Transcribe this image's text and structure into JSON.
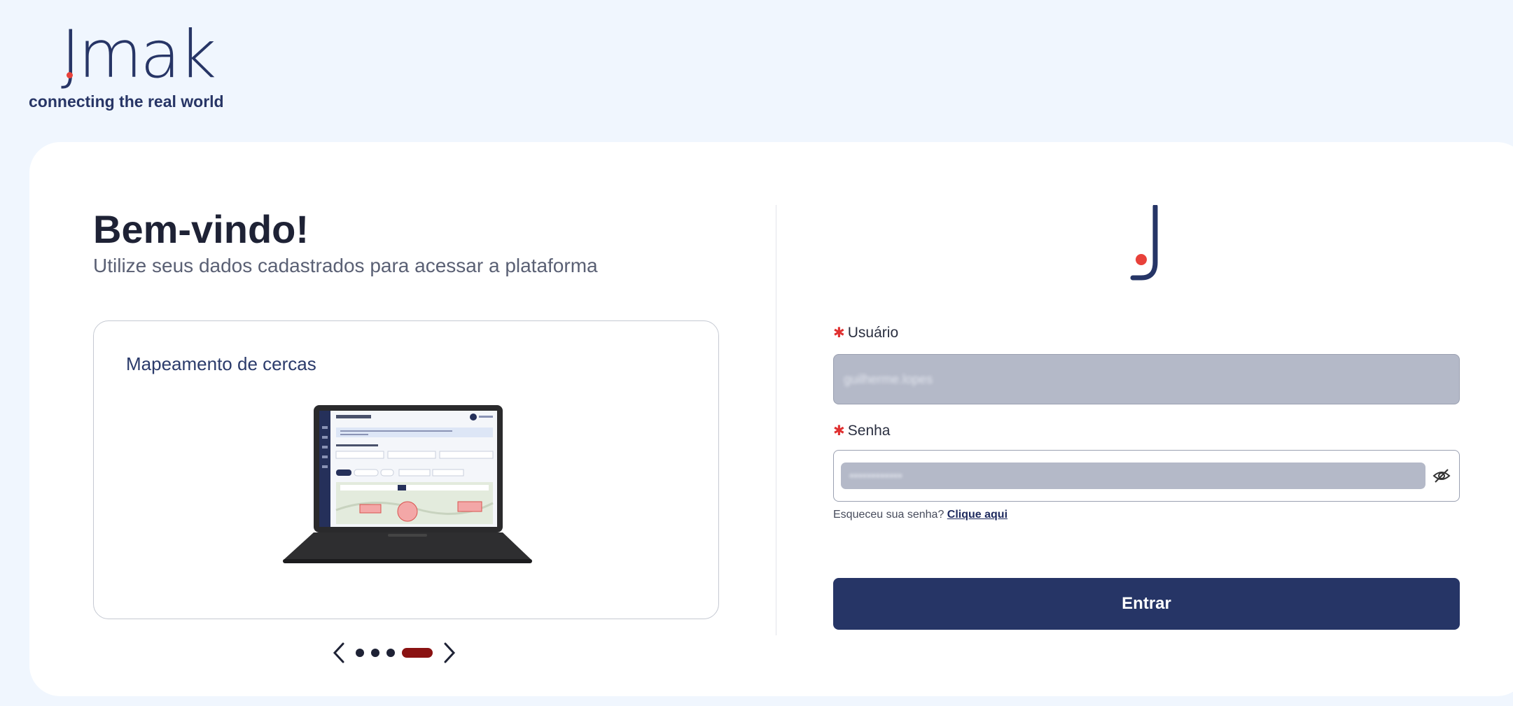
{
  "brand": {
    "logo_text": "Jmak",
    "tagline": "connecting the real world"
  },
  "welcome": {
    "title": "Bem-vindo!",
    "subtitle": "Utilize seus dados cadastrados para acessar a plataforma"
  },
  "carousel": {
    "slide_title": "Mapeamento de cercas",
    "total_slides": 4,
    "active_slide": 4
  },
  "form": {
    "username_label": "Usuário",
    "username_value": "guilherme.lopes",
    "password_label": "Senha",
    "password_value": "••••••••••••",
    "forgot_text": "Esqueceu sua senha?",
    "forgot_link": "Clique aqui",
    "submit_label": "Entrar"
  },
  "colors": {
    "background": "#f0f6fe",
    "primary": "#263566",
    "accent_dot": "#e8413a",
    "carousel_active": "#8a1212",
    "required": "#e03131",
    "autofill": "#b4b9c8"
  },
  "icons": {
    "prev": "chevron-left-icon",
    "next": "chevron-right-icon",
    "password_toggle": "eye-off-icon",
    "logo_mark": "j-logo-icon"
  }
}
